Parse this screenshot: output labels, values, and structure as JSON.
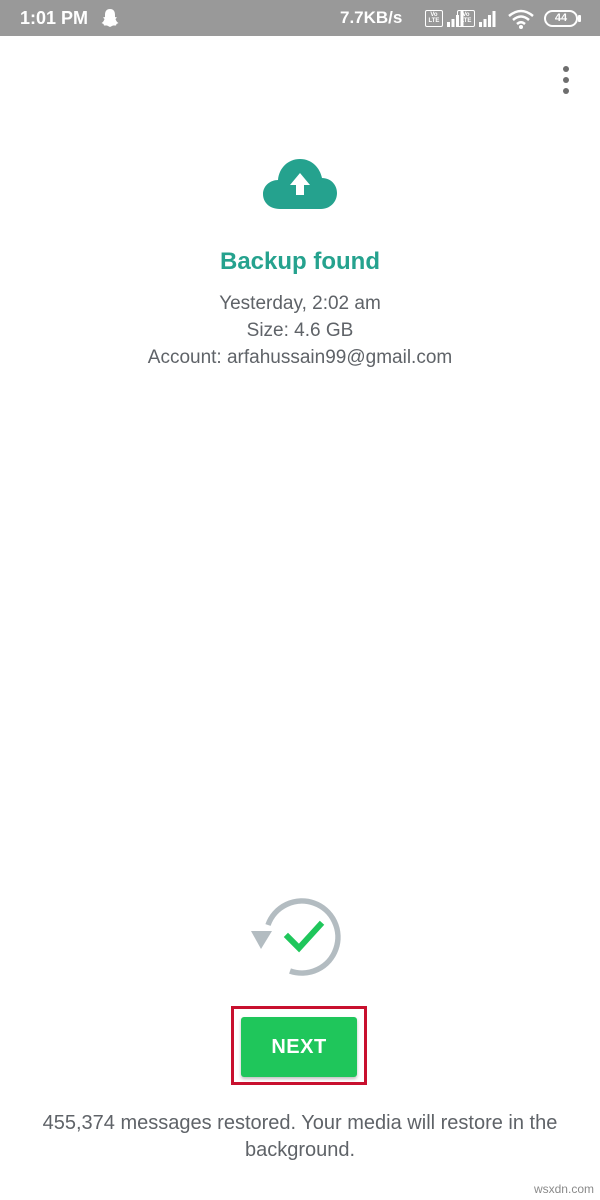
{
  "status_bar": {
    "time": "1:01 PM",
    "network_speed": "7.7KB/s",
    "volte_label": "Vo LTE",
    "battery_level": "44",
    "icons": [
      "snapchat-icon",
      "volte-icon",
      "signal-icon",
      "volte-icon",
      "signal-icon",
      "wifi-icon",
      "battery-icon"
    ]
  },
  "toolbar": {
    "more_icon": "more-vertical-icon"
  },
  "backup": {
    "icon": "cloud-upload-icon",
    "title": "Backup found",
    "date": "Yesterday, 2:02 am",
    "size": "Size: 4.6 GB",
    "account": "Account: arfahussain99@gmail.com",
    "accent_color": "#25a28e"
  },
  "restore": {
    "icon": "restore-complete-icon",
    "next_label": "NEXT",
    "button_color": "#1fc65b",
    "message": "455,374 messages restored. Your media will restore in the background."
  },
  "watermark": "wsxdn.com"
}
